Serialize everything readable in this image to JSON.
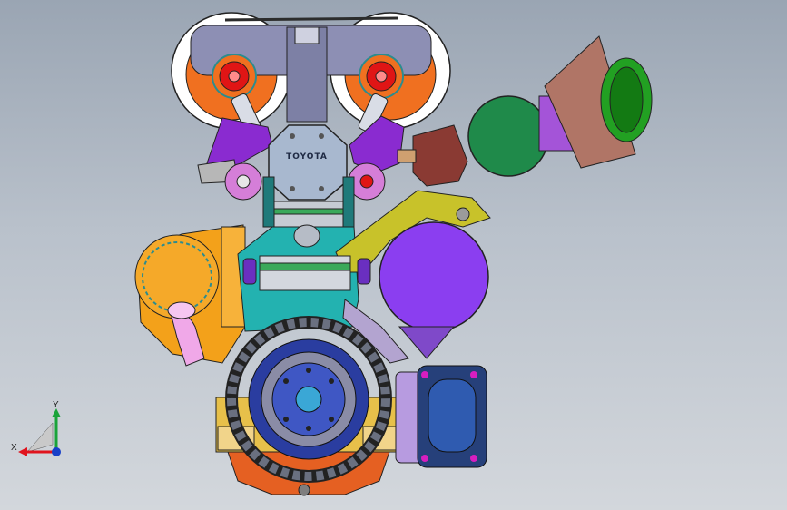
{
  "viewport": {
    "background_top": "#9aa5b3",
    "background_bottom": "#d3d7dc"
  },
  "model": {
    "emblem_text": "TOYOTA",
    "colors": {
      "cam_cover": "#8d8fb4",
      "cam_ring": "#ffffff",
      "cam_gear": "#f07020",
      "cam_center": "#e01515",
      "bracket_purple": "#8a2bd0",
      "water_pump": "#f3a11a",
      "alternator": "#8b3ef0",
      "alt_bracket": "#c8c22a",
      "throttle_body": "#1f8a4a",
      "intake_funnel": "#b07566",
      "intake_lip": "#22a022",
      "flywheel": "#2a3da0",
      "starter": "#26407a",
      "oil_pan": "#e56022",
      "block_teal": "#23b2b0",
      "block_gold": "#e7c04a",
      "inlet_pipe": "#f0a8e8",
      "piston_gray": "#c6cbd3",
      "pulley_pink": "#d57ed8"
    }
  },
  "axes": {
    "x_label": "X",
    "y_label": "Y",
    "x_color": "#e0141e",
    "y_color": "#1aa33a",
    "z_color": "#1840c8"
  }
}
